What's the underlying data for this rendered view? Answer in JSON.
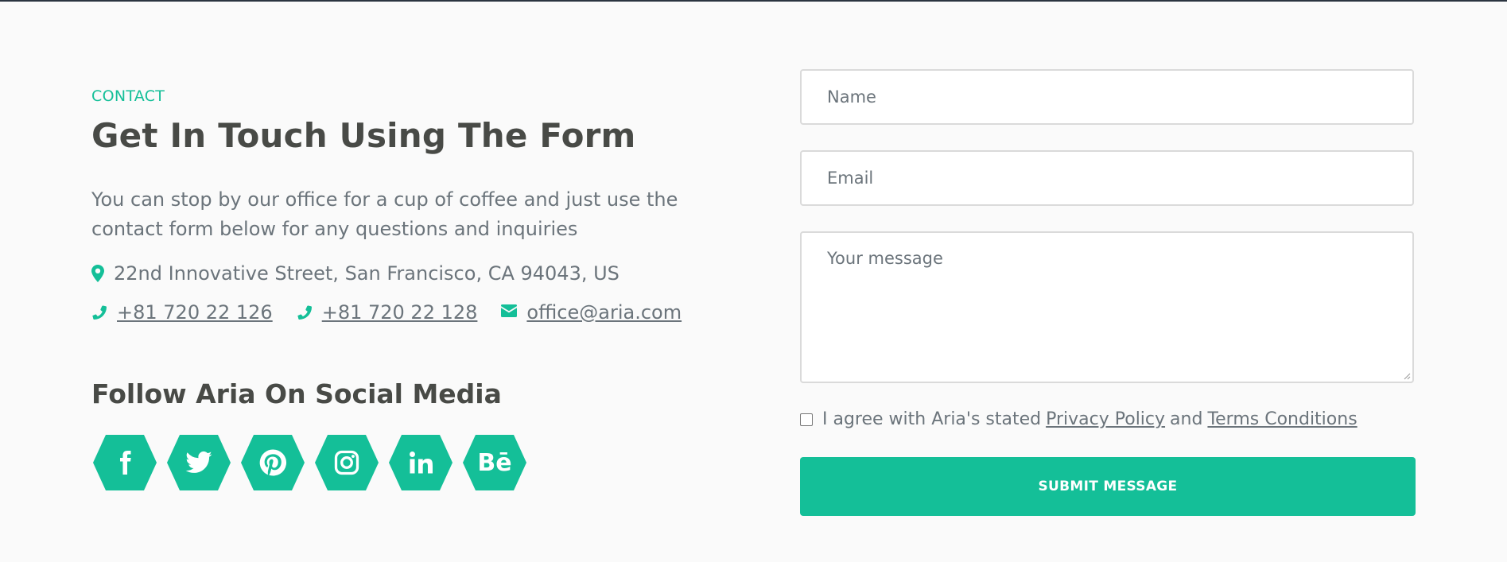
{
  "colors": {
    "accent": "#14bf98",
    "heading": "#484a46",
    "text": "#6b747b",
    "background": "#fafafa"
  },
  "contact": {
    "eyebrow": "CONTACT",
    "heading": "Get In Touch Using The Form",
    "intro": "You can stop by our office for a cup of coffee and just use the contact form below for any questions and inquiries",
    "address": {
      "icon": "map-marker-icon",
      "text": "22nd Innovative Street, San Francisco, CA 94043, US"
    },
    "phones": [
      {
        "icon": "phone-icon",
        "text": "+81 720 22 126"
      },
      {
        "icon": "phone-icon",
        "text": "+81 720 22 128"
      }
    ],
    "email": {
      "icon": "envelope-icon",
      "text": "office@aria.com"
    }
  },
  "social": {
    "heading": "Follow Aria On Social Media",
    "icons": [
      "facebook-icon",
      "twitter-icon",
      "pinterest-icon",
      "instagram-icon",
      "linkedin-icon",
      "behance-icon"
    ],
    "behance_glyph": "Bē"
  },
  "form": {
    "name_placeholder": "Name",
    "email_placeholder": "Email",
    "message_placeholder": "Your message",
    "agree_prefix": "I agree with Aria's stated",
    "privacy_link": "Privacy Policy",
    "and": "and",
    "terms_link": "Terms Conditions",
    "submit_label": "SUBMIT MESSAGE"
  }
}
